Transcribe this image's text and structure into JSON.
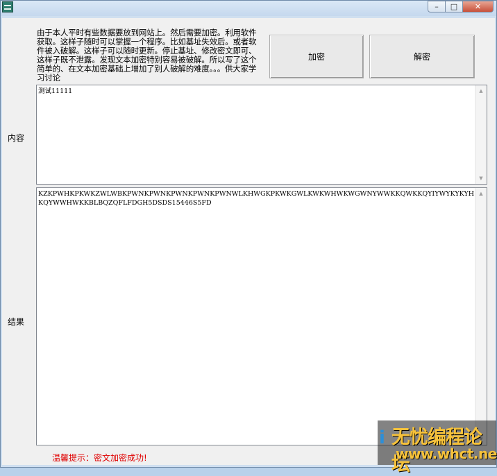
{
  "window": {
    "caption_buttons": {
      "minimize": "–",
      "maximize": "□",
      "close": "✕"
    }
  },
  "description": "由于本人平时有些数据要放到网站上。然后需要加密。利用软件获取。这样子随时可以掌握一个程序。比如基址失效后。或者软件被入破解。这样子可以随时更新。停止基址、修改密文即可、这样子既不泄露。发现文本加密特别容易被破解。所以写了这个简单的、在文本加密基础上增加了别人破解的难度。。。供大家学习讨论",
  "buttons": {
    "encrypt": "加密",
    "decrypt": "解密"
  },
  "labels": {
    "content": "内容",
    "result": "结果"
  },
  "content_text": "测试11111",
  "result_text": "KZKPWHKPKWKZWLWBKPWNKPWNKPWNKPWNKPWNWLKHWGKPKWKGWLKWKWHWKWGWNYWWKKQWKKQYIYWYKYKYHKQYWWHWKKBLBQZQFLFDGH5DSDS15446S5FD",
  "status": "温馨提示：密文加密成功!",
  "watermark": {
    "title": "无忧编程论坛",
    "url": "www.whct.net"
  },
  "colors": {
    "status": "#e00000",
    "window_frame": "#cfdff0",
    "client": "#f0f0f0"
  },
  "icons": {
    "app": "app-icon",
    "scroll_up": "scroll-up-icon",
    "scroll_down": "scroll-down-icon"
  }
}
